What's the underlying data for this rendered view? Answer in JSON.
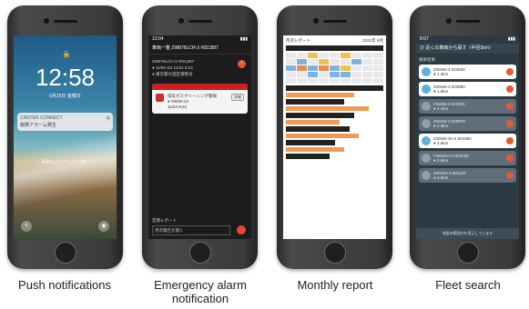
{
  "phones": {
    "push": {
      "time": "12:58",
      "date": "6月25日 金曜日",
      "notif_app": "CANTER CONNECT",
      "notif_time": "今",
      "notif_text": "故障アラーム発生",
      "hint": "画面を上にスワイプして開く",
      "caption": "Push notifications"
    },
    "alarm": {
      "status": "13:04",
      "title": "車両一覧 ZW876LCH-3 #921887",
      "info_line1": "ZW876LCH-3 #921887",
      "info_line2": "● 11/08 /24    11/24 9:23",
      "info_line3": "● 東京都大田区東糀谷",
      "alarm_title": "排気ガスクリーニング警報",
      "alarm_code": "● 00000-24",
      "alarm_time": "11/24 9:23",
      "alarm_button": "詳細",
      "footer_label": "定期レポート",
      "footer_value": "月次報告を開く",
      "caption_line1": "Emergency alarm",
      "caption_line2": "notification"
    },
    "report": {
      "title": "月次レポート",
      "subtitle": "2021年 6月",
      "caption": "Monthly report"
    },
    "fleet": {
      "status": "8:07",
      "title": "ひ 近くの車両から探す（半径3km）",
      "section": "検索結果",
      "items": [
        {
          "name": "ZW450-3 023940",
          "sub": "● 1.4km"
        },
        {
          "name": "ZW450-3 023980",
          "sub": "● 1.6km"
        },
        {
          "name": "FW450-3 022941",
          "sub": "● 2.1km"
        },
        {
          "name": "ZW450-3 020978",
          "sub": "● 2.3km"
        },
        {
          "name": "ZW450-3H 4 001060",
          "sub": "● 2.5km"
        },
        {
          "name": "FW45GH 3 001030",
          "sub": "● 2.8km"
        },
        {
          "name": "ZW4SH 3 001120",
          "sub": "● 3.0km"
        }
      ],
      "footer": "地図の範囲内を表示しています",
      "caption": "Fleet search"
    }
  }
}
